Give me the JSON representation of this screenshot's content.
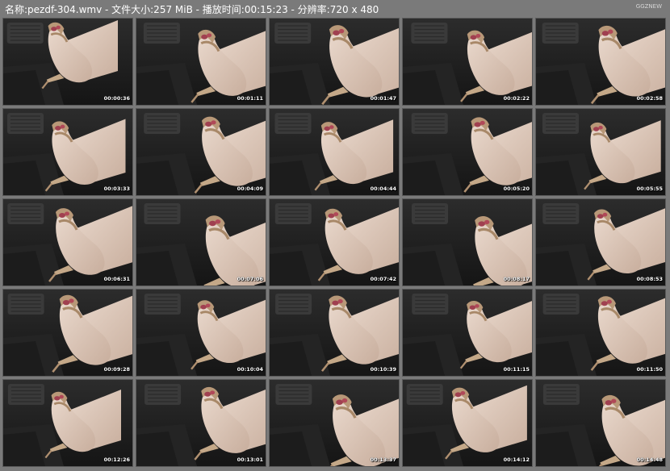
{
  "header": {
    "title": "名称:pezdf-304.wmv - 文件大小:257 MiB - 播放时间:00:15:23 - 分辨率:720 x 480",
    "watermark": "GGZNEW"
  },
  "thumbnails": [
    {
      "timestamp": "00:00:36"
    },
    {
      "timestamp": "00:01:11"
    },
    {
      "timestamp": "00:01:47"
    },
    {
      "timestamp": "00:02:22"
    },
    {
      "timestamp": "00:02:58"
    },
    {
      "timestamp": "00:03:33"
    },
    {
      "timestamp": "00:04:09"
    },
    {
      "timestamp": "00:04:44"
    },
    {
      "timestamp": "00:05:20"
    },
    {
      "timestamp": "00:05:55"
    },
    {
      "timestamp": "00:06:31"
    },
    {
      "timestamp": "00:07:06"
    },
    {
      "timestamp": "00:07:42"
    },
    {
      "timestamp": "00:08:17"
    },
    {
      "timestamp": "00:08:53"
    },
    {
      "timestamp": "00:09:28"
    },
    {
      "timestamp": "00:10:04"
    },
    {
      "timestamp": "00:10:39"
    },
    {
      "timestamp": "00:11:15"
    },
    {
      "timestamp": "00:11:50"
    },
    {
      "timestamp": "00:12:26"
    },
    {
      "timestamp": "00:13:01"
    },
    {
      "timestamp": "00:13:37"
    },
    {
      "timestamp": "00:14:12"
    },
    {
      "timestamp": "00:14:48"
    }
  ]
}
